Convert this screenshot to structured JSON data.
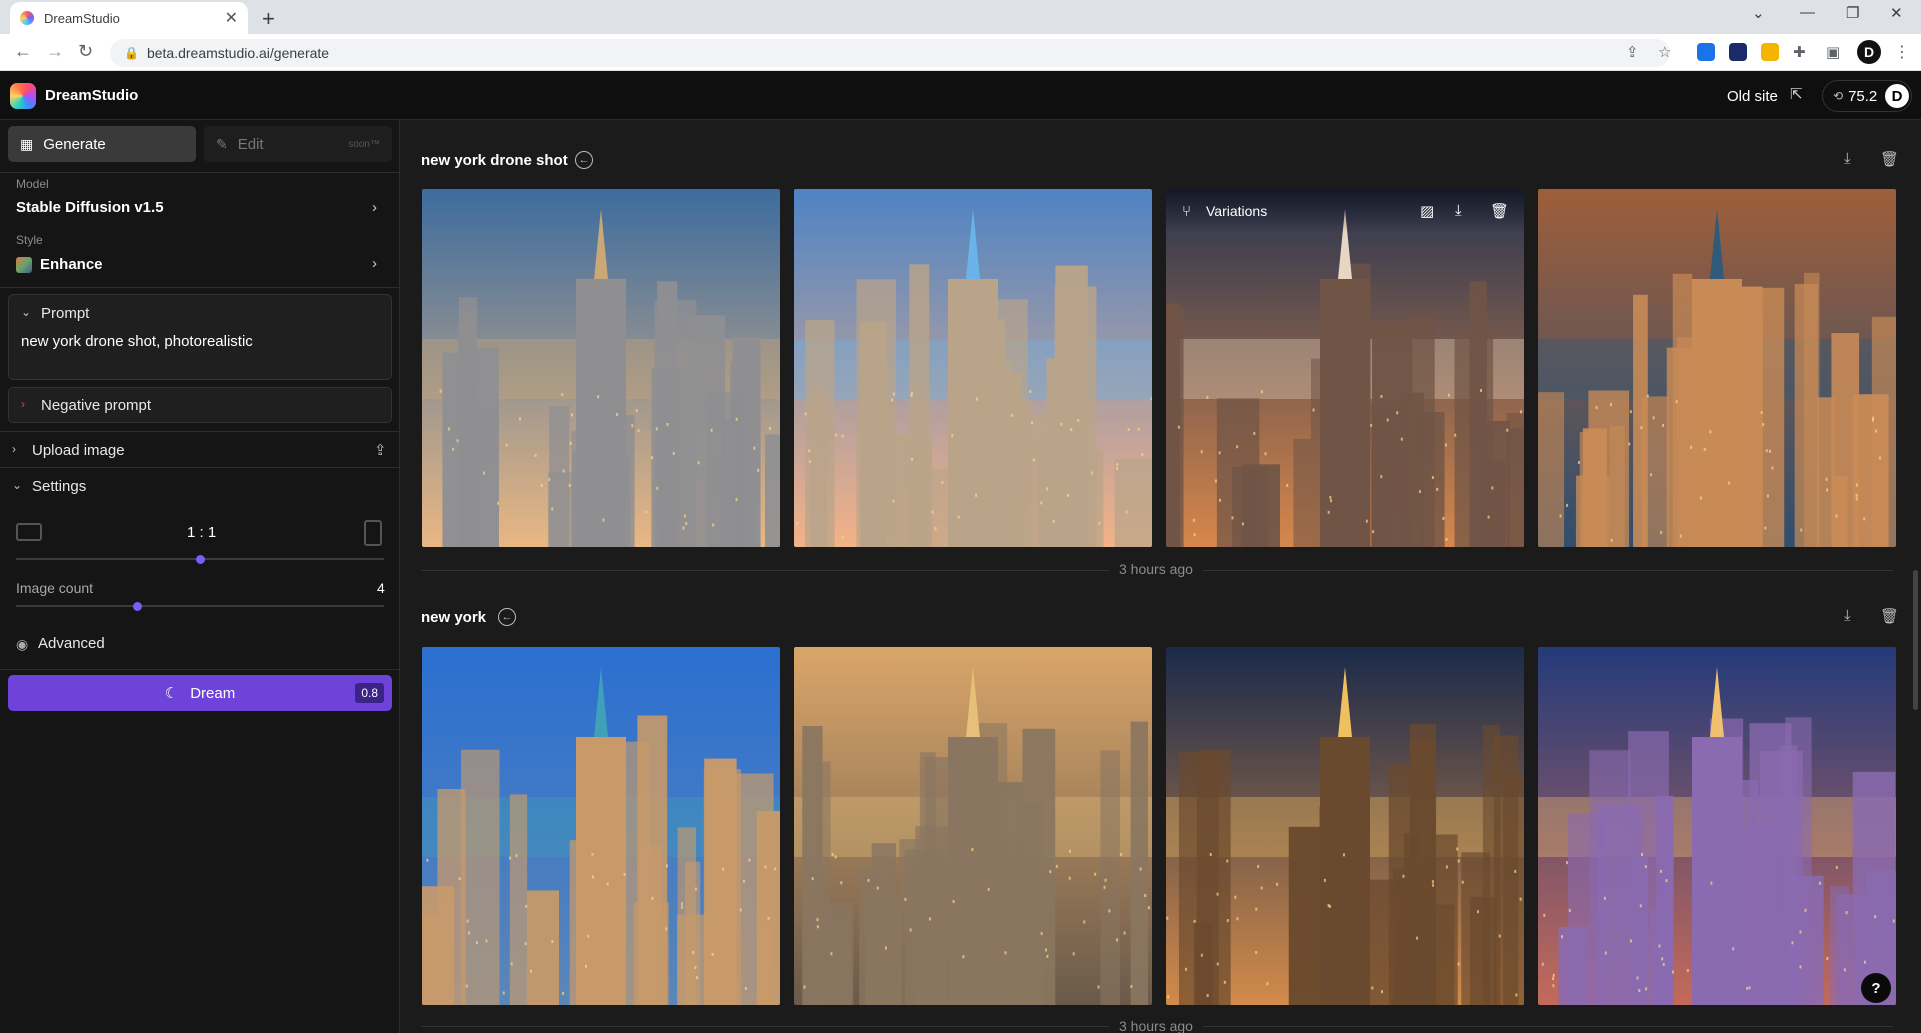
{
  "browser": {
    "tab_title": "DreamStudio",
    "url": "beta.dreamstudio.ai/generate",
    "new_tab": "+",
    "tab_close": "✕",
    "profile_initial": "D"
  },
  "header": {
    "app_name": "DreamStudio",
    "old_site": "Old site",
    "credits": "75.2",
    "avatar_initial": "D"
  },
  "sidebar": {
    "generate_tab": "Generate",
    "edit_tab": "Edit",
    "soon": "soon™",
    "model_label": "Model",
    "model_value": "Stable Diffusion v1.5",
    "style_label": "Style",
    "style_value": "Enhance",
    "prompt_title": "Prompt",
    "prompt_text": "new york drone shot, photorealistic",
    "negative_prompt": "Negative prompt",
    "upload_image": "Upload image",
    "settings": "Settings",
    "ratio": "1 : 1",
    "ratio_level": 0.5,
    "image_count_label": "Image count",
    "image_count_value": "4",
    "image_count_level": 0.33,
    "advanced": "Advanced",
    "dream_button": "Dream",
    "dream_cost": "0.8"
  },
  "main": {
    "groups": [
      {
        "title": "new york drone shot",
        "timestamp": "3 hours ago",
        "hover_label": "Variations",
        "images": [
          {
            "sky": [
              "#3d6c9e",
              "#e9b783"
            ],
            "building": "#8f8f92",
            "accent": "#c9a776"
          },
          {
            "sky": [
              "#4e83c4",
              "#f4b287"
            ],
            "building": "#b9a489",
            "accent": "#6ab3e8"
          },
          {
            "sky": [
              "#2a3550",
              "#d7874b"
            ],
            "building": "#705446",
            "accent": "#e8d6c4"
          },
          {
            "sky": [
              "#9e5e3a",
              "#2f4e6e"
            ],
            "building": "#c98b56",
            "accent": "#2f5a7a"
          }
        ]
      },
      {
        "title": "new york",
        "timestamp": "3 hours ago",
        "images": [
          {
            "sky": [
              "#2b6fd1",
              "#5b86b8"
            ],
            "building": "#c89a6a",
            "accent": "#3fa0b8"
          },
          {
            "sky": [
              "#d9a56a",
              "#6a5a4a"
            ],
            "building": "#8a7660",
            "accent": "#e6c07a"
          },
          {
            "sky": [
              "#1b2a4a",
              "#d28b4a"
            ],
            "building": "#6a4a2e",
            "accent": "#f0c060"
          },
          {
            "sky": [
              "#243a7a",
              "#c46a5a"
            ],
            "building": "#8a6ab0",
            "accent": "#f0c070"
          }
        ]
      }
    ]
  }
}
